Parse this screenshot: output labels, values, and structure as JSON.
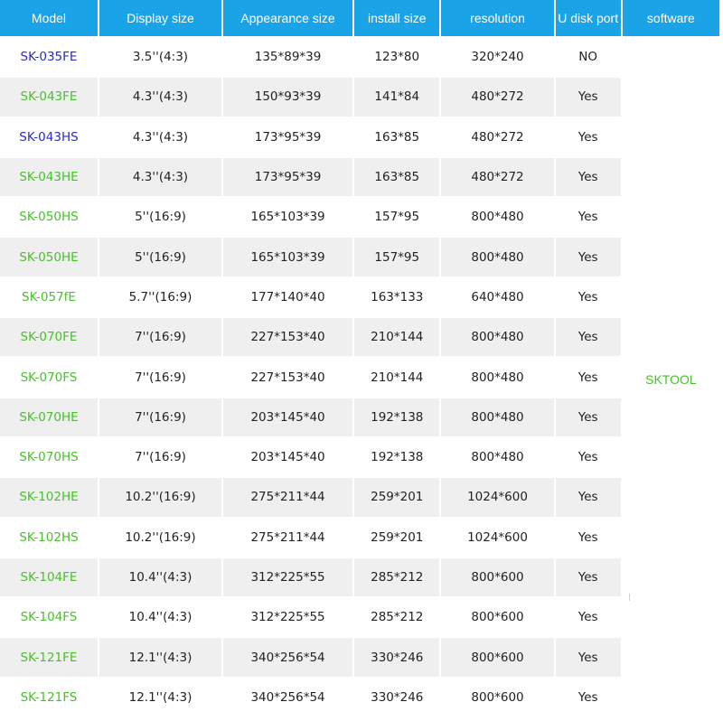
{
  "headers": [
    "Model",
    "Display size",
    "Appearance size",
    "install size",
    "resolution",
    "U disk port",
    "software"
  ],
  "software": "SKTOOL",
  "colors": {
    "header_bg": "#1aa3e6",
    "model_blue": "#2b2bc0",
    "model_green": "#48c02b",
    "stripe": "#efefef"
  },
  "rows": [
    {
      "model": "SK-035FE",
      "color": "blue",
      "display": "3.5''(4:3)",
      "appearance": "135*89*39",
      "install": "123*80",
      "resolution": "320*240",
      "usb": "NO"
    },
    {
      "model": "SK-043FE",
      "color": "green",
      "display": "4.3''(4:3)",
      "appearance": "150*93*39",
      "install": "141*84",
      "resolution": "480*272",
      "usb": "Yes"
    },
    {
      "model": "SK-043HS",
      "color": "blue",
      "display": "4.3''(4:3)",
      "appearance": "173*95*39",
      "install": "163*85",
      "resolution": "480*272",
      "usb": "Yes"
    },
    {
      "model": "SK-043HE",
      "color": "green",
      "display": "4.3''(4:3)",
      "appearance": "173*95*39",
      "install": "163*85",
      "resolution": "480*272",
      "usb": "Yes"
    },
    {
      "model": "SK-050HS",
      "color": "green",
      "display": "5''(16:9)",
      "appearance": "165*103*39",
      "install": "157*95",
      "resolution": "800*480",
      "usb": "Yes"
    },
    {
      "model": "SK-050HE",
      "color": "green",
      "display": "5''(16:9)",
      "appearance": "165*103*39",
      "install": "157*95",
      "resolution": "800*480",
      "usb": "Yes"
    },
    {
      "model": "SK-057fE",
      "color": "green",
      "display": "5.7''(16:9)",
      "appearance": "177*140*40",
      "install": "163*133",
      "resolution": "640*480",
      "usb": "Yes"
    },
    {
      "model": "SK-070FE",
      "color": "green",
      "display": "7''(16:9)",
      "appearance": "227*153*40",
      "install": "210*144",
      "resolution": "800*480",
      "usb": "Yes"
    },
    {
      "model": "SK-070FS",
      "color": "green",
      "display": "7''(16:9)",
      "appearance": "227*153*40",
      "install": "210*144",
      "resolution": "800*480",
      "usb": "Yes"
    },
    {
      "model": "SK-070HE",
      "color": "green",
      "display": "7''(16:9)",
      "appearance": "203*145*40",
      "install": "192*138",
      "resolution": "800*480",
      "usb": "Yes"
    },
    {
      "model": "SK-070HS",
      "color": "green",
      "display": "7''(16:9)",
      "appearance": "203*145*40",
      "install": "192*138",
      "resolution": "800*480",
      "usb": "Yes"
    },
    {
      "model": "SK-102HE",
      "color": "green",
      "display": "10.2''(16:9)",
      "appearance": "275*211*44",
      "install": "259*201",
      "resolution": "1024*600",
      "usb": "Yes"
    },
    {
      "model": "SK-102HS",
      "color": "green",
      "display": "10.2''(16:9)",
      "appearance": "275*211*44",
      "install": "259*201",
      "resolution": "1024*600",
      "usb": "Yes"
    },
    {
      "model": "SK-104FE",
      "color": "green",
      "display": "10.4''(4:3)",
      "appearance": "312*225*55",
      "install": "285*212",
      "resolution": "800*600",
      "usb": "Yes"
    },
    {
      "model": "SK-104FS",
      "color": "green",
      "display": "10.4''(4:3)",
      "appearance": "312*225*55",
      "install": "285*212",
      "resolution": "800*600",
      "usb": "Yes"
    },
    {
      "model": "SK-121FE",
      "color": "green",
      "display": "12.1''(4:3)",
      "appearance": "340*256*54",
      "install": "330*246",
      "resolution": "800*600",
      "usb": "Yes"
    },
    {
      "model": "SK-121FS",
      "color": "green",
      "display": "12.1''(4:3)",
      "appearance": "340*256*54",
      "install": "330*246",
      "resolution": "800*600",
      "usb": "Yes"
    }
  ]
}
